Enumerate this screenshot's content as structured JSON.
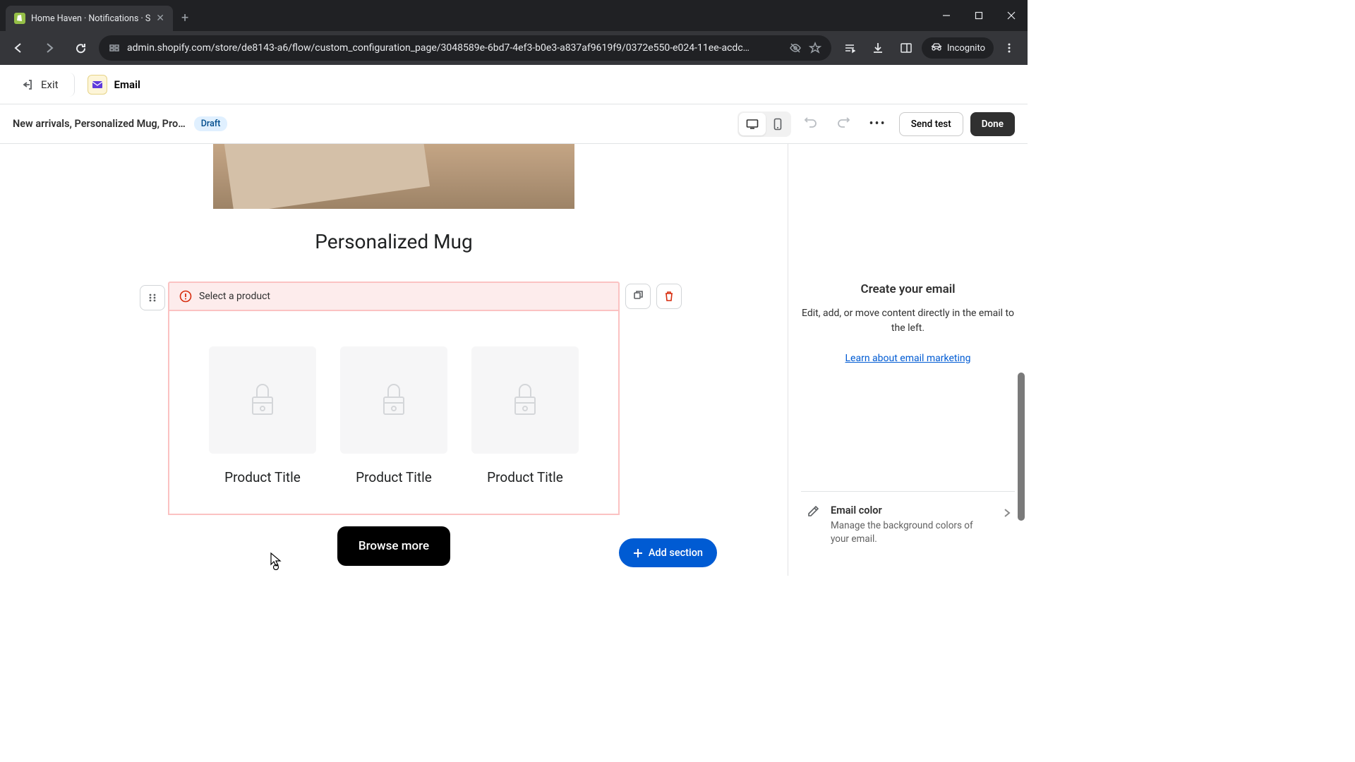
{
  "browser": {
    "tab_title": "Home Haven · Notifications · S",
    "url": "admin.shopify.com/store/de8143-a6/flow/custom_configuration_page/3048589e-6bd7-4ef3-b0e3-a837af9619f9/0372e550-e024-11ee-acdc…",
    "incognito": "Incognito"
  },
  "app_header": {
    "exit": "Exit",
    "email": "Email"
  },
  "sub_header": {
    "title": "New arrivals, Personalized Mug, Pro…",
    "status": "Draft",
    "send_test": "Send test",
    "done": "Done"
  },
  "canvas": {
    "main_product": "Personalized Mug",
    "error_message": "Select a product",
    "placeholders": [
      "Product Title",
      "Product Title",
      "Product Title"
    ],
    "browse_more": "Browse more",
    "add_section": "Add section"
  },
  "panel": {
    "heading": "Create your email",
    "desc": "Edit, add, or move content directly in the email to the left.",
    "link": "Learn about email marketing",
    "email_color": {
      "title": "Email color",
      "desc": "Manage the background colors of your email."
    }
  }
}
